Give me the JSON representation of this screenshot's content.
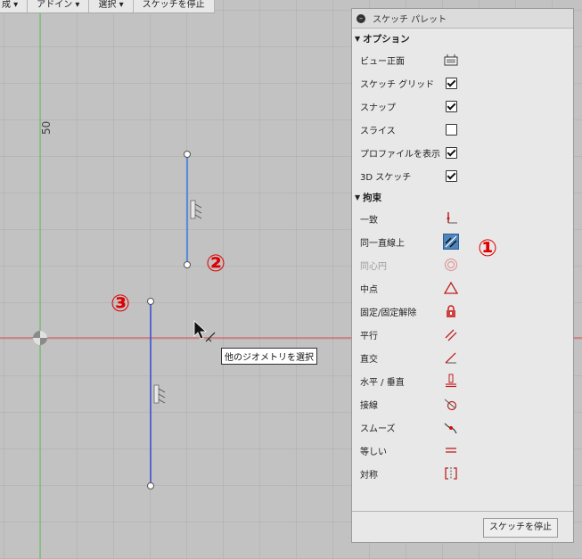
{
  "menu": {
    "items": [
      "成 ▾",
      "アドイン ▾",
      "選択 ▾",
      "スケッチを停止"
    ]
  },
  "canvas": {
    "axis_label": "50",
    "tooltip": "他のジオメトリを選択",
    "markers": [
      "①",
      "②",
      "③"
    ]
  },
  "palette": {
    "title": "スケッチ パレット",
    "options_header": "オプション",
    "options": [
      {
        "label": "ビュー正面",
        "control": "view-icon"
      },
      {
        "label": "スケッチ グリッド",
        "control": "checkbox",
        "checked": true
      },
      {
        "label": "スナップ",
        "control": "checkbox",
        "checked": true
      },
      {
        "label": "スライス",
        "control": "checkbox",
        "checked": false
      },
      {
        "label": "プロファイルを表示",
        "control": "checkbox",
        "checked": true
      },
      {
        "label": "3D スケッチ",
        "control": "checkbox",
        "checked": true
      }
    ],
    "constraints_header": "拘束",
    "constraints": [
      {
        "label": "一致",
        "icon": "coincident-icon"
      },
      {
        "label": "同一直線上",
        "icon": "collinear-icon",
        "active": true
      },
      {
        "label": "同心円",
        "icon": "concentric-icon",
        "disabled": true
      },
      {
        "label": "中点",
        "icon": "midpoint-icon"
      },
      {
        "label": "固定/固定解除",
        "icon": "lock-icon"
      },
      {
        "label": "平行",
        "icon": "parallel-icon"
      },
      {
        "label": "直交",
        "icon": "perpendicular-icon"
      },
      {
        "label": "水平 / 垂直",
        "icon": "horizontal-vertical-icon"
      },
      {
        "label": "接線",
        "icon": "tangent-icon"
      },
      {
        "label": "スムーズ",
        "icon": "smooth-icon"
      },
      {
        "label": "等しい",
        "icon": "equal-icon"
      },
      {
        "label": "対称",
        "icon": "symmetry-icon"
      }
    ],
    "stop_button": "スケッチを停止"
  },
  "colors": {
    "accent": "#e00000",
    "active_button": "#4f85bd",
    "line_selected": "#5b8bd8",
    "line": "#3b4fd6"
  }
}
